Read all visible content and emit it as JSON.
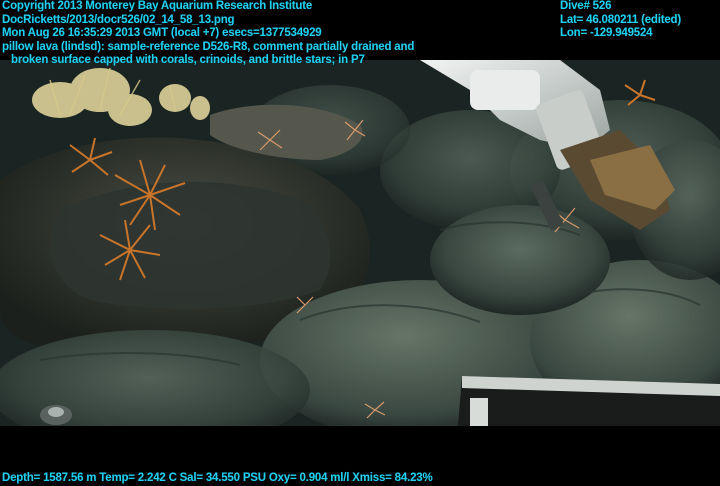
{
  "overlay": {
    "copyright": "Copyright 2013 Monterey Bay Aquarium Research Institute",
    "file_path": "DocRicketts/2013/docr526/02_14_58_13.png",
    "timestamp": "Mon Aug 26 16:35:29 2013 GMT (local +7)  esecs=1377534929",
    "description_line1": "pillow lava (lindsd): sample-reference D526-R8, comment partially drained and",
    "description_line2": "broken surface capped with corals, crinoids, and brittle stars; in P7",
    "dive": "Dive# 526",
    "lat": "Lat= 46.080211 (edited)",
    "lon": "Lon= -129.949524",
    "telemetry": "Depth= 1587.56 m  Temp= 2.242 C  Sal= 34.550 PSU  Oxy= 0.904 ml/l  Xmiss= 84.23%"
  },
  "colors": {
    "overlay_text": "#1fd0ef",
    "background": "#000000"
  }
}
